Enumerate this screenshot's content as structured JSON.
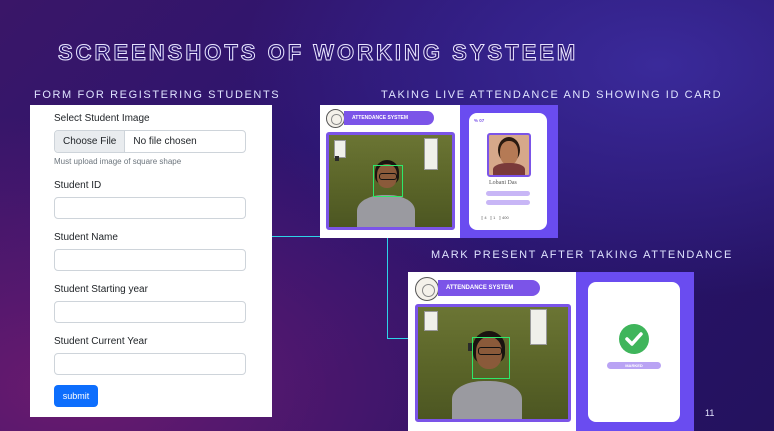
{
  "slide": {
    "title": "SCREENSHOTS OF WORKING SYSTEEM",
    "page_number": "11"
  },
  "captions": {
    "form": "FORM FOR  REGISTERING STUDENTS",
    "live": "TAKING LIVE ATTENDANCE AND SHOWING ID CARD",
    "mark": "MARK  PRESENT AFTER TAKING ATTENDANCE"
  },
  "form": {
    "image_label": "Select Student Image",
    "choose_file_label": "Choose File",
    "no_file_text": "No file chosen",
    "image_help": "Must upload image of square shape",
    "student_id_label": "Student ID",
    "student_id_value": "",
    "student_name_label": "Student Name",
    "student_name_value": "",
    "starting_year_label": "Student Starting year",
    "starting_year_value": "",
    "current_year_label": "Student Current Year",
    "current_year_value": "",
    "submit_label": "submit"
  },
  "attendance_app": {
    "header_label": "ATTENDANCE SYSTEM",
    "id_card": {
      "student_name": "Lobani Das",
      "marked_label": "MARKED"
    }
  },
  "colors": {
    "accent_purple": "#7b54e8",
    "submit_blue": "#0d6efd",
    "connector": "#2dd4e8",
    "check_green": "#3fb55b"
  }
}
